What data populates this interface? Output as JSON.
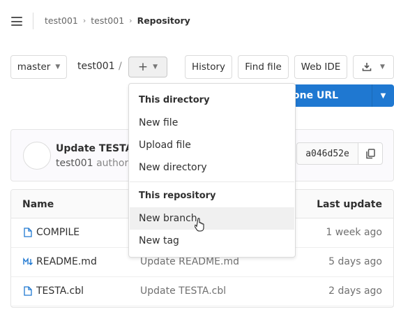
{
  "breadcrumb": {
    "items": [
      "test001",
      "test001"
    ],
    "current": "Repository"
  },
  "controls": {
    "branch": "master",
    "path": "test001",
    "path_sep": "/",
    "add_icon": "plus-icon",
    "history": "History",
    "find_file": "Find file",
    "web_ide": "Web IDE",
    "download_icon": "download-icon",
    "clone_label": "one URL"
  },
  "dropdown": {
    "section1": "This directory",
    "dir_items": [
      "New file",
      "Upload file",
      "New directory"
    ],
    "section2": "This repository",
    "repo_items": [
      "New branch",
      "New tag"
    ]
  },
  "commit": {
    "title": "Update TESTA.c",
    "author": "test001",
    "authored": "authored",
    "sha": "a046d52e"
  },
  "table": {
    "headers": {
      "name": "Name",
      "last_update": "Last update"
    },
    "rows": [
      {
        "name": "COMPILE",
        "message": "",
        "date": "1 week ago",
        "icon": "file-icon"
      },
      {
        "name": "README.md",
        "message": "Update README.md",
        "date": "5 days ago",
        "icon": "markdown-icon"
      },
      {
        "name": "TESTA.cbl",
        "message": "Update TESTA.cbl",
        "date": "2 days ago",
        "icon": "file-icon"
      }
    ]
  },
  "colors": {
    "primary": "#1f78d1",
    "link_icon": "#1f78d1"
  }
}
